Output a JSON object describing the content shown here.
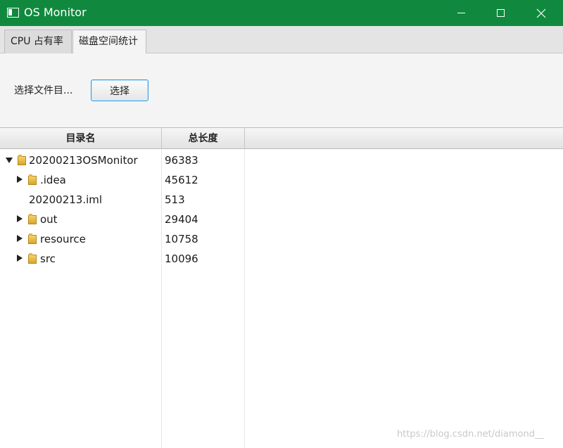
{
  "window": {
    "title": "OS Monitor"
  },
  "tabs": [
    {
      "label": "CPU 占有率"
    },
    {
      "label": "磁盘空间统计"
    }
  ],
  "toolbar": {
    "dir_label": "选择文件目...",
    "select_button": "选择"
  },
  "table": {
    "columns": [
      "目录名",
      "总长度"
    ],
    "rows": [
      {
        "name": "20200213OSMonitor",
        "length": "96383",
        "expanded": true,
        "folder": true
      },
      {
        "name": ".idea",
        "length": "45612",
        "expanded": false,
        "folder": true
      },
      {
        "name": "20200213.iml",
        "length": "513",
        "folder": false
      },
      {
        "name": "out",
        "length": "29404",
        "expanded": false,
        "folder": true
      },
      {
        "name": "resource",
        "length": "10758",
        "expanded": false,
        "folder": true
      },
      {
        "name": "src",
        "length": "10096",
        "expanded": false,
        "folder": true
      }
    ]
  },
  "watermark": "https://blog.csdn.net/diamond__",
  "colors": {
    "titlebar": "#10893e",
    "focus_border": "#2b9de0"
  }
}
